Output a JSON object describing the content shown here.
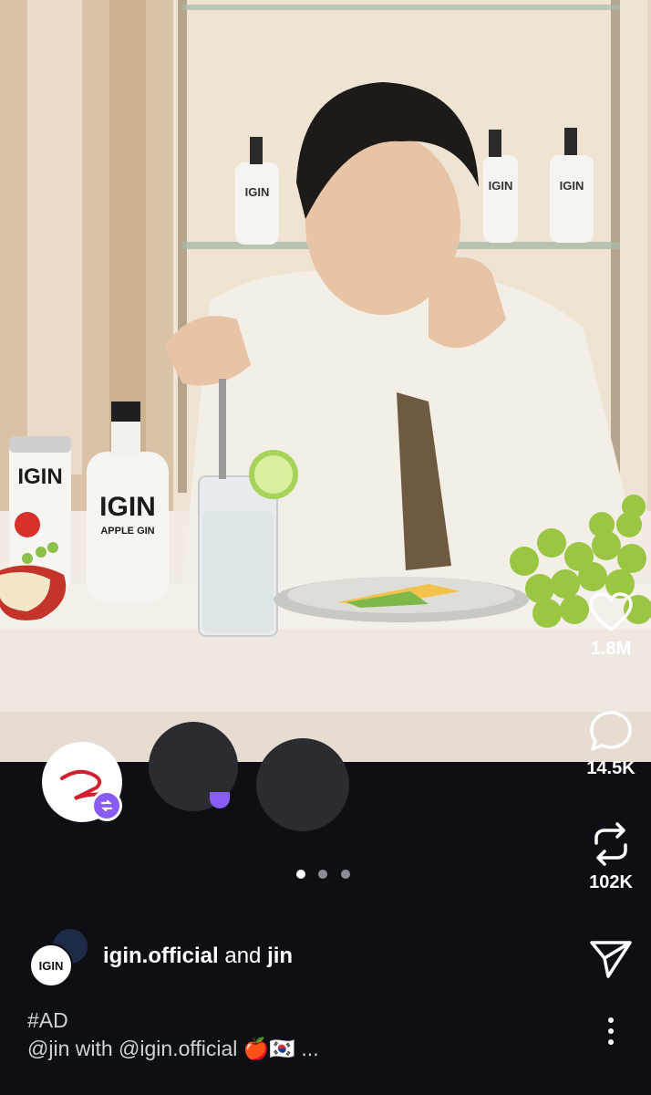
{
  "post": {
    "stats": {
      "likes": "1.8M",
      "comments": "14.5K",
      "reposts": "102K"
    },
    "carousel": {
      "total": 3,
      "active_index": 0
    },
    "authors": {
      "primary": "igin.official",
      "joiner": "and",
      "secondary": "jin",
      "avatar_text": "IGIN"
    },
    "photo_text": {
      "can_brand": "IGIN",
      "bottle_brand": "IGIN",
      "bottle_sub": "APPLE GIN",
      "shelf_bottle": "IGIN"
    },
    "caption": {
      "line1": "#AD",
      "line2": "@jin with @igin.official 🍎🇰🇷 ..."
    }
  },
  "colors": {
    "background": "#0d0f14",
    "accent_purple": "#8a5cf6",
    "text": "#ffffff",
    "muted_text": "#cfd3d8"
  }
}
